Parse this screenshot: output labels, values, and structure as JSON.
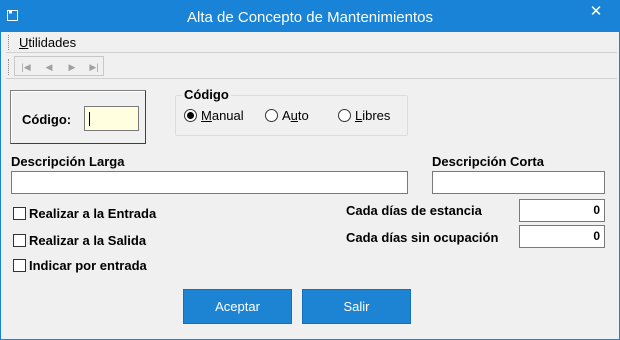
{
  "window": {
    "title": "Alta de Concepto de Mantenimientos",
    "close_glyph": "✕"
  },
  "menu": {
    "utilidades_first": "U",
    "utilidades_rest": "tilidades"
  },
  "nav": {
    "first": "|◀",
    "prev": "◀",
    "next": "▶",
    "last": "▶|"
  },
  "codigo": {
    "label": "Código:",
    "value": ""
  },
  "codigo_group": {
    "title": "Código",
    "options": [
      {
        "u": "M",
        "rest": "anual",
        "selected": true
      },
      {
        "pre": "A",
        "u": "u",
        "rest": "to",
        "selected": false
      },
      {
        "u": "L",
        "rest": "ibres",
        "selected": false
      }
    ]
  },
  "descripcion_larga": {
    "label": "Descripción Larga",
    "value": ""
  },
  "descripcion_corta": {
    "label": "Descripción Corta",
    "value": ""
  },
  "checks": [
    {
      "label": "Realizar a la Entrada",
      "checked": false
    },
    {
      "label": "Realizar a la Salida",
      "checked": false
    },
    {
      "label": "Indicar por entrada",
      "checked": false
    }
  ],
  "cada_dias_estancia": {
    "label": "Cada días de estancia",
    "value": "0"
  },
  "cada_dias_sin_ocupacion": {
    "label": "Cada días sin ocupación",
    "value": "0"
  },
  "buttons": {
    "aceptar": "Aceptar",
    "salir": "Salir"
  },
  "colors": {
    "titlebar": "#1883d7",
    "button": "#1d84d4",
    "codigo_bg": "#ffffe0"
  }
}
